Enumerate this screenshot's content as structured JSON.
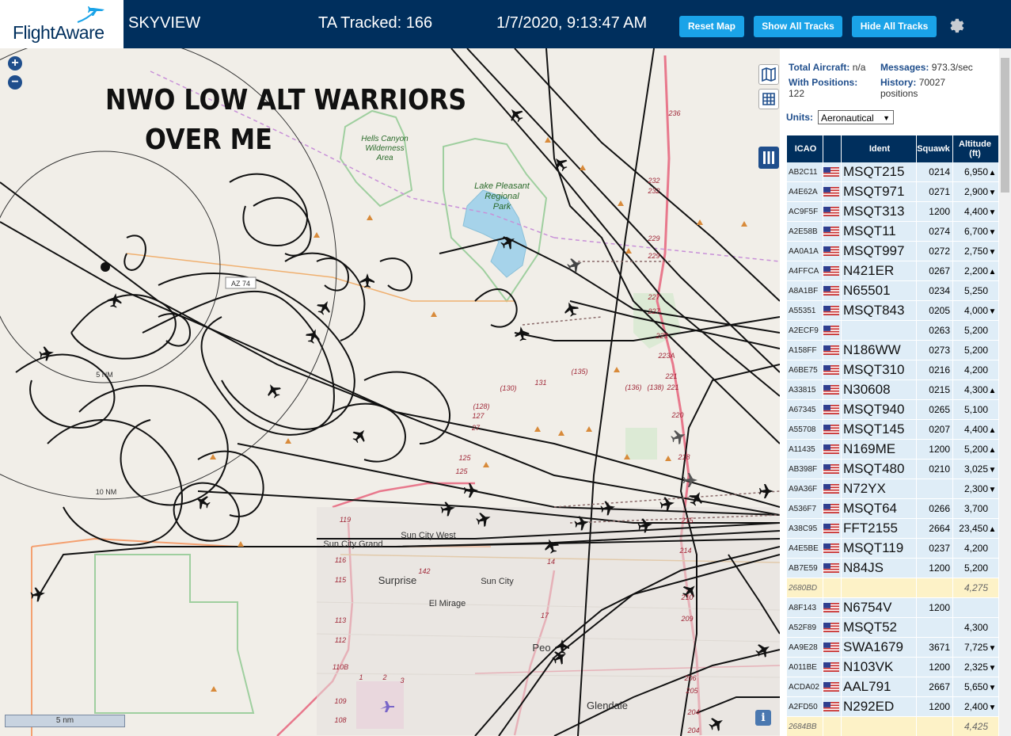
{
  "header": {
    "brand": "FlightAware",
    "app_name": "SKYVIEW",
    "tracked_label": "TA Tracked: 166",
    "datetime": "1/7/2020, 9:13:47 AM",
    "buttons": {
      "reset": "Reset Map",
      "show": "Show All Tracks",
      "hide": "Hide All Tracks"
    },
    "settings_icon": "gear-icon"
  },
  "overlay": {
    "line1": "NWO LOW ALT WARRIORS",
    "line2": "OVER ME"
  },
  "map": {
    "labels": {
      "hells_canyon": [
        "Hells Canyon",
        "Wilderness",
        "Area"
      ],
      "lake": [
        "Lake Pleasant",
        "Regional",
        "Park"
      ],
      "surprise": "Surprise",
      "sun_city": "Sun City",
      "sun_city_west": "Sun City West",
      "el_mirage": "El Mirage",
      "glendale": "Glendale",
      "peoria": "Peo",
      "sun_city_grand": "Sun City Grand",
      "az74": "AZ 74",
      "ring5": "5 NM",
      "ring10": "10 NM",
      "road_labels": [
        "236",
        "232",
        "232",
        "229",
        "229",
        "227",
        "227",
        "223",
        "223A",
        "221",
        "221",
        "220",
        "218",
        "215",
        "214",
        "210",
        "209",
        "206",
        "205",
        "204",
        "204",
        "(135)",
        "(130)",
        "(128)",
        "(136)",
        "(138)",
        "131",
        "127",
        "27",
        "125",
        "125",
        "119",
        "116",
        "115",
        "113",
        "112",
        "110B",
        "109",
        "108",
        "142",
        "17",
        "14",
        "1",
        "2",
        "3"
      ]
    },
    "scale_label": "5 nm",
    "info_label": "i",
    "zoom": {
      "in": "+",
      "out": "−"
    }
  },
  "panel": {
    "total_aircraft_label": "Total Aircraft:",
    "total_aircraft_value": "n/a",
    "messages_label": "Messages:",
    "messages_value": "973.3/sec",
    "with_positions_label": "With Positions:",
    "with_positions_value": "122",
    "history_label": "History:",
    "history_value": "70027",
    "history_unit": "positions",
    "units_label": "Units:",
    "units_value": "Aeronautical",
    "columns": [
      "ICAO",
      "",
      "Ident",
      "Squawk",
      "Altitude (ft)"
    ],
    "rows": [
      {
        "icao": "AB2C11",
        "ident": "MSQT215",
        "squawk": "0214",
        "alt": "6,950",
        "trend": "▲",
        "hl": false
      },
      {
        "icao": "A4E62A",
        "ident": "MSQT971",
        "squawk": "0271",
        "alt": "2,900",
        "trend": "▼",
        "hl": false
      },
      {
        "icao": "AC9F5F",
        "ident": "MSQT313",
        "squawk": "1200",
        "alt": "4,400",
        "trend": "▼",
        "hl": false
      },
      {
        "icao": "A2E58B",
        "ident": "MSQT11",
        "squawk": "0274",
        "alt": "6,700",
        "trend": "▼",
        "hl": false
      },
      {
        "icao": "AA0A1A",
        "ident": "MSQT997",
        "squawk": "0272",
        "alt": "2,750",
        "trend": "▼",
        "hl": false
      },
      {
        "icao": "A4FFCA",
        "ident": "N421ER",
        "squawk": "0267",
        "alt": "2,200",
        "trend": "▲",
        "hl": false
      },
      {
        "icao": "A8A1BF",
        "ident": "N65501",
        "squawk": "0234",
        "alt": "5,250",
        "trend": "",
        "hl": false
      },
      {
        "icao": "A55351",
        "ident": "MSQT843",
        "squawk": "0205",
        "alt": "4,000",
        "trend": "▼",
        "hl": false
      },
      {
        "icao": "A2ECF9",
        "ident": "",
        "squawk": "0263",
        "alt": "5,200",
        "trend": "",
        "hl": false
      },
      {
        "icao": "A158FF",
        "ident": "N186WW",
        "squawk": "0273",
        "alt": "5,200",
        "trend": "",
        "hl": false
      },
      {
        "icao": "A6BE75",
        "ident": "MSQT310",
        "squawk": "0216",
        "alt": "4,200",
        "trend": "",
        "hl": false
      },
      {
        "icao": "A33815",
        "ident": "N30608",
        "squawk": "0215",
        "alt": "4,300",
        "trend": "▲",
        "hl": false
      },
      {
        "icao": "A67345",
        "ident": "MSQT940",
        "squawk": "0265",
        "alt": "5,100",
        "trend": "",
        "hl": false
      },
      {
        "icao": "A55708",
        "ident": "MSQT145",
        "squawk": "0207",
        "alt": "4,400",
        "trend": "▲",
        "hl": false
      },
      {
        "icao": "A11435",
        "ident": "N169ME",
        "squawk": "1200",
        "alt": "5,200",
        "trend": "▲",
        "hl": false
      },
      {
        "icao": "AB398F",
        "ident": "MSQT480",
        "squawk": "0210",
        "alt": "3,025",
        "trend": "▼",
        "hl": false
      },
      {
        "icao": "A9A36F",
        "ident": "N72YX",
        "squawk": "",
        "alt": "2,300",
        "trend": "▼",
        "hl": false
      },
      {
        "icao": "A536F7",
        "ident": "MSQT64",
        "squawk": "0266",
        "alt": "3,700",
        "trend": "",
        "hl": false
      },
      {
        "icao": "A38C95",
        "ident": "FFT2155",
        "squawk": "2664",
        "alt": "23,450",
        "trend": "▲",
        "hl": false
      },
      {
        "icao": "A4E5BE",
        "ident": "MSQT119",
        "squawk": "0237",
        "alt": "4,200",
        "trend": "",
        "hl": false
      },
      {
        "icao": "AB7E59",
        "ident": "N84JS",
        "squawk": "1200",
        "alt": "5,200",
        "trend": "",
        "hl": false
      },
      {
        "icao": "2680BD",
        "ident": "",
        "squawk": "",
        "alt": "4,275",
        "trend": "",
        "hl": true
      },
      {
        "icao": "A8F143",
        "ident": "N6754V",
        "squawk": "1200",
        "alt": "",
        "trend": "",
        "hl": false
      },
      {
        "icao": "A52F89",
        "ident": "MSQT52",
        "squawk": "",
        "alt": "4,300",
        "trend": "",
        "hl": false
      },
      {
        "icao": "AA9E28",
        "ident": "SWA1679",
        "squawk": "3671",
        "alt": "7,725",
        "trend": "▼",
        "hl": false
      },
      {
        "icao": "A011BE",
        "ident": "N103VK",
        "squawk": "1200",
        "alt": "2,325",
        "trend": "▼",
        "hl": false
      },
      {
        "icao": "ACDA02",
        "ident": "AAL791",
        "squawk": "2667",
        "alt": "5,650",
        "trend": "▼",
        "hl": false
      },
      {
        "icao": "A2FD50",
        "ident": "N292ED",
        "squawk": "1200",
        "alt": "2,400",
        "trend": "▼",
        "hl": false
      },
      {
        "icao": "2684BB",
        "ident": "",
        "squawk": "",
        "alt": "4,425",
        "trend": "",
        "hl": true
      }
    ]
  },
  "colors": {
    "header_bg": "#002f5d",
    "button": "#1aa3e8",
    "row_bg": "#dfedf7",
    "row_highlight": "#fdf2c7",
    "road_red": "#e8788c",
    "water": "#9ecfe6"
  }
}
